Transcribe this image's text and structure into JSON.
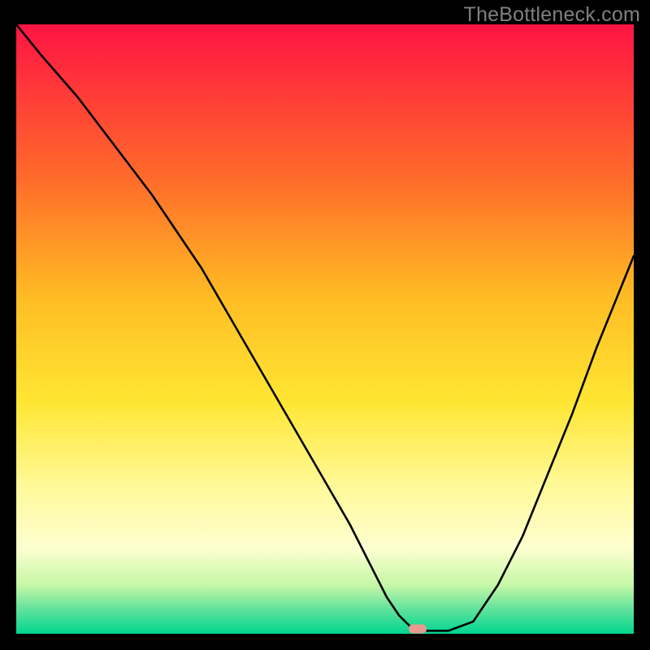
{
  "watermark": "TheBottleneck.com",
  "chart_data": {
    "type": "line",
    "title": "",
    "xlabel": "",
    "ylabel": "",
    "xlim": [
      0,
      100
    ],
    "ylim": [
      0,
      100
    ],
    "x": [
      0,
      4,
      10,
      16,
      22,
      26,
      30,
      34,
      38,
      42,
      46,
      50,
      54,
      56,
      58,
      60,
      62,
      64,
      66,
      70,
      74,
      78,
      82,
      86,
      90,
      94,
      98,
      100
    ],
    "y": [
      100,
      95,
      88,
      80,
      72,
      66,
      60,
      53,
      46,
      39,
      32,
      25,
      18,
      14,
      10,
      6,
      3,
      1,
      0.5,
      0.5,
      2,
      8,
      16,
      26,
      36,
      47,
      57,
      62
    ],
    "gradient_stops": [
      {
        "offset": 0,
        "color": "#ff1444"
      },
      {
        "offset": 25,
        "color": "#ff6a2a"
      },
      {
        "offset": 45,
        "color": "#ffbd24"
      },
      {
        "offset": 62,
        "color": "#ffe633"
      },
      {
        "offset": 76,
        "color": "#fff99a"
      },
      {
        "offset": 86,
        "color": "#fdffd0"
      },
      {
        "offset": 92,
        "color": "#c6f7a6"
      },
      {
        "offset": 96,
        "color": "#60e29c"
      },
      {
        "offset": 100,
        "color": "#00d68f"
      }
    ],
    "marker": {
      "x": 65,
      "y": 0.8,
      "color": "#e79a8f"
    }
  }
}
